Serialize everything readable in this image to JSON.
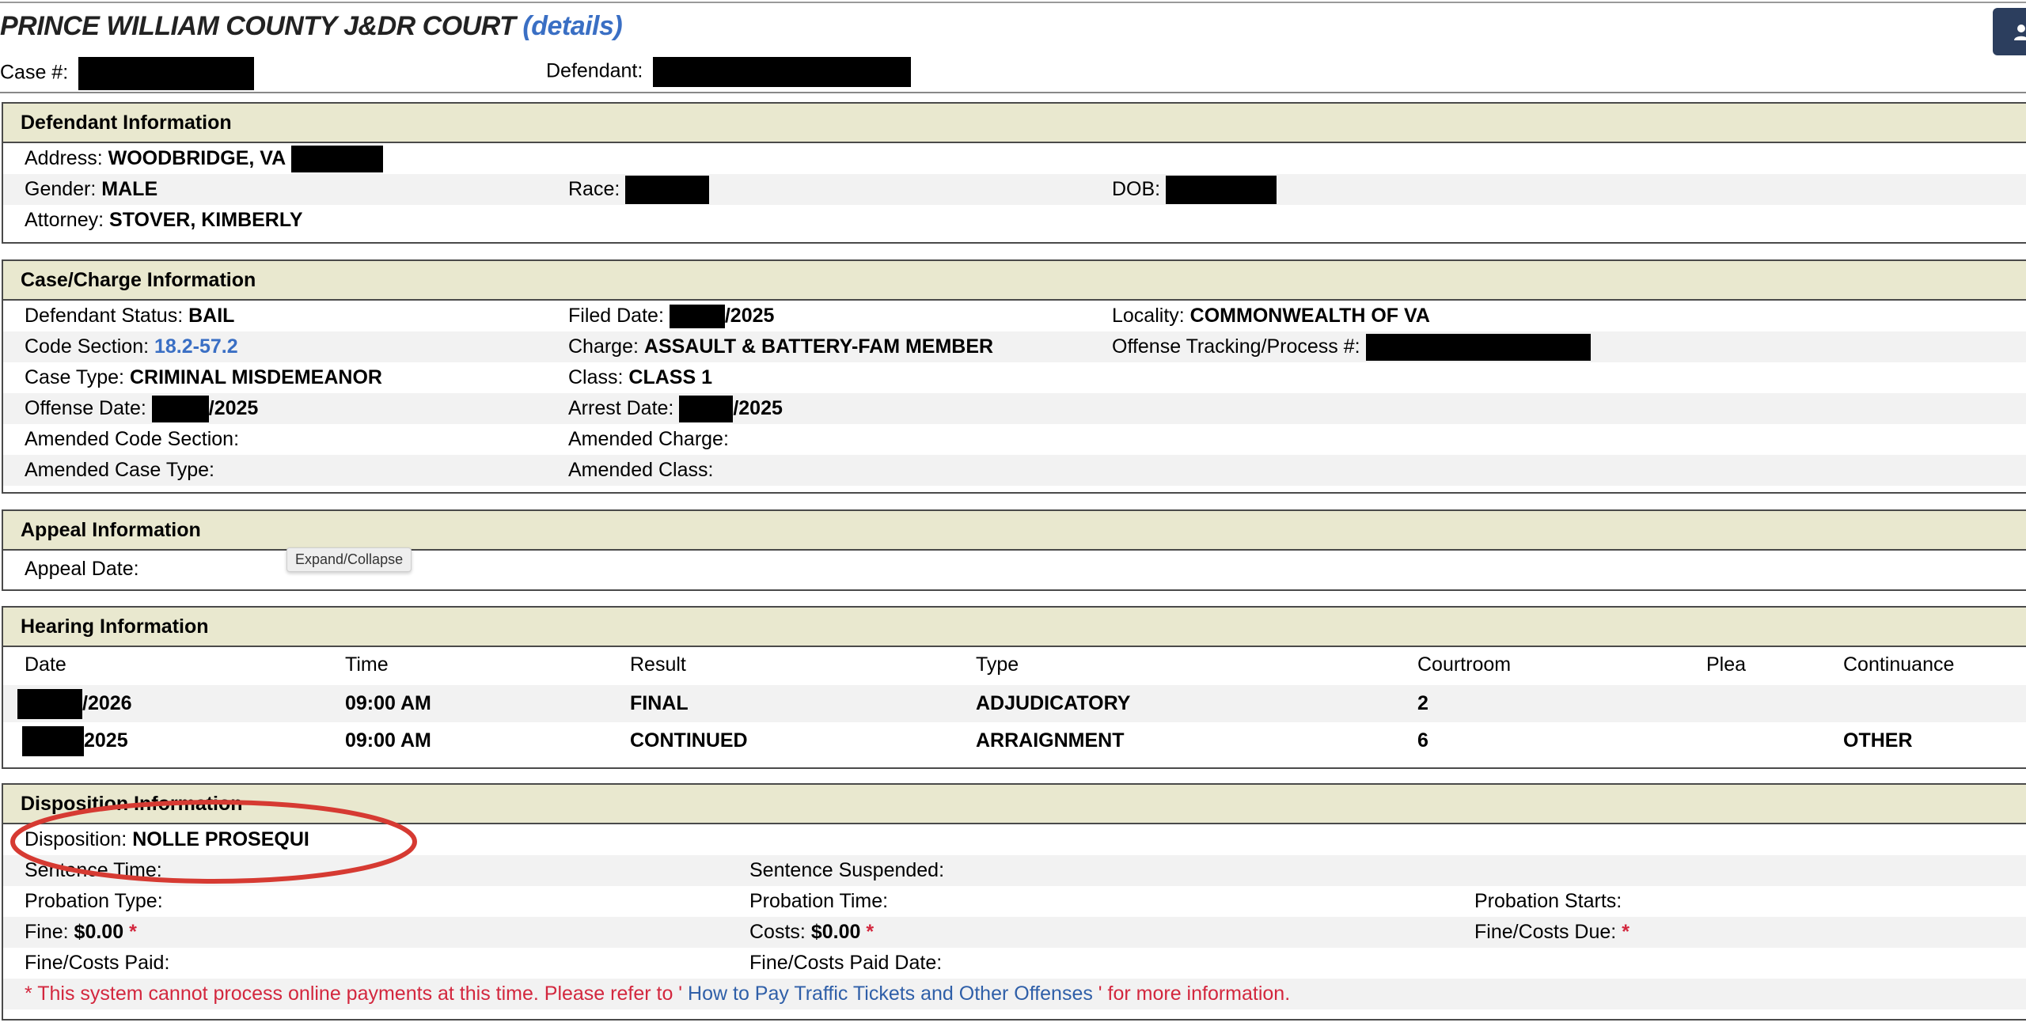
{
  "header": {
    "court_name": "PRINCE WILLIAM COUNTY J&DR COURT",
    "details_link": "(details)",
    "case_no_label": "Case #:",
    "defendant_label": "Defendant:",
    "user_button_icon": "user-icon"
  },
  "defendant_info": {
    "title": "Defendant Information",
    "address_label": "Address:",
    "address_value": "WOODBRIDGE, VA",
    "gender_label": "Gender:",
    "gender_value": "MALE",
    "race_label": "Race:",
    "dob_label": "DOB:",
    "attorney_label": "Attorney:",
    "attorney_value": "STOVER, KIMBERLY"
  },
  "case_info": {
    "title": "Case/Charge Information",
    "status_label": "Defendant Status:",
    "status_value": "BAIL",
    "filed_label": "Filed Date:",
    "filed_value": "/2025",
    "locality_label": "Locality:",
    "locality_value": "COMMONWEALTH OF VA",
    "code_label": "Code Section:",
    "code_value": "18.2-57.2",
    "charge_label": "Charge:",
    "charge_value": "ASSAULT & BATTERY-FAM MEMBER",
    "otn_label": "Offense Tracking/Process #:",
    "casetype_label": "Case Type:",
    "casetype_value": "CRIMINAL MISDEMEANOR",
    "class_label": "Class:",
    "class_value": "CLASS 1",
    "offense_label": "Offense Date:",
    "offense_value": "/2025",
    "arrest_label": "Arrest Date:",
    "arrest_value": "/2025",
    "amended_code_label": "Amended Code Section:",
    "amended_charge_label": "Amended Charge:",
    "amended_casetype_label": "Amended Case Type:",
    "amended_class_label": "Amended Class:"
  },
  "appeal_info": {
    "title": "Appeal Information",
    "appeal_date_label": "Appeal Date:",
    "tooltip": "Expand/Collapse"
  },
  "hearing_info": {
    "title": "Hearing Information",
    "columns": [
      "Date",
      "Time",
      "Result",
      "Type",
      "Courtroom",
      "Plea",
      "Continuance"
    ],
    "rows": [
      {
        "date": "/2026",
        "time": "09:00 AM",
        "result": "FINAL",
        "type": "ADJUDICATORY",
        "courtroom": "2",
        "plea": "",
        "continuance": ""
      },
      {
        "date": "2025",
        "time": "09:00 AM",
        "result": "CONTINUED",
        "type": "ARRAIGNMENT",
        "courtroom": "6",
        "plea": "",
        "continuance": "OTHER"
      }
    ]
  },
  "disposition_info": {
    "title": "Disposition Information",
    "disposition_label": "Disposition:",
    "disposition_value": "NOLLE PROSEQUI",
    "sentence_time_label": "Sentence Time:",
    "sentence_suspended_label": "Sentence Suspended:",
    "probation_type_label": "Probation Type:",
    "probation_time_label": "Probation Time:",
    "probation_starts_label": "Probation Starts:",
    "fine_label": "Fine:",
    "fine_value": "$0.00",
    "costs_label": "Costs:",
    "costs_value": "$0.00",
    "fine_costs_due_label": "Fine/Costs Due:",
    "fine_costs_paid_label": "Fine/Costs Paid:",
    "fine_costs_paid_date_label": "Fine/Costs Paid Date:",
    "asterisk": "*",
    "notice_prefix": "* This system cannot process online payments at this time. Please refer to '",
    "notice_link": " How to Pay Traffic Tickets and Other Offenses ",
    "notice_suffix": "' for more information."
  },
  "colors": {
    "section_header_bg": "#e9e8cf",
    "link_blue": "#3a6fc4",
    "notice_red": "#d3273e",
    "annotation_red": "#d63a32"
  }
}
